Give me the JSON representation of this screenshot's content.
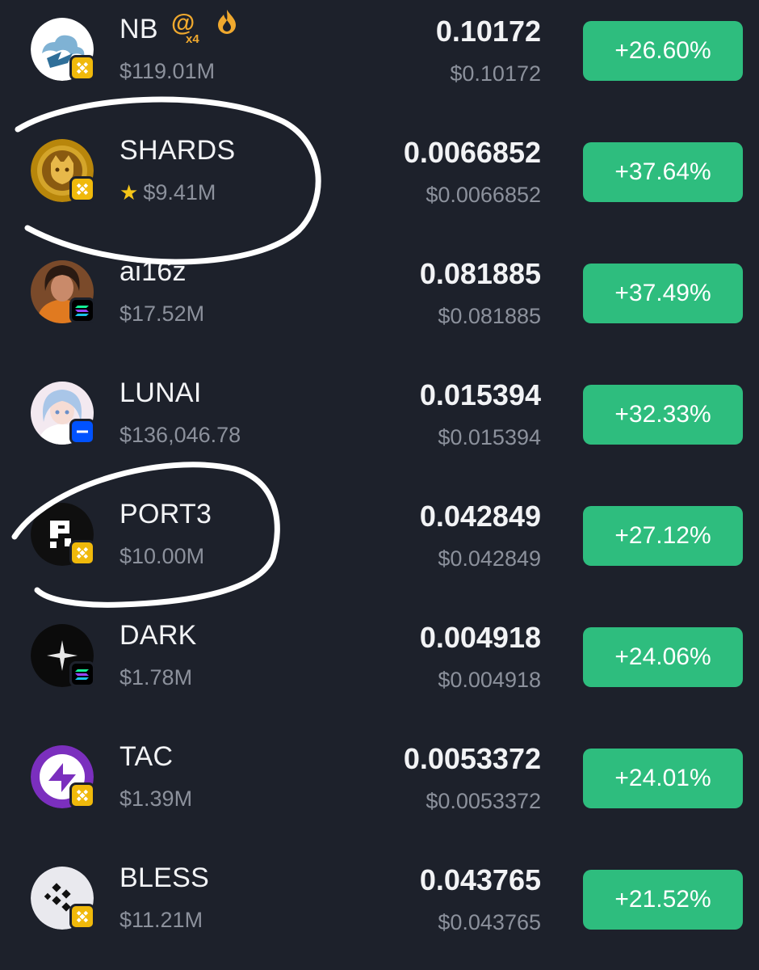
{
  "tokens": [
    {
      "name": "NB",
      "market_cap": "$119.01M",
      "price": "0.10172",
      "usd_price": "$0.10172",
      "change": "+26.60%",
      "chain": "bnb-chain-icon",
      "logo": "cloud-logo-icon",
      "badges": {
        "at_multiplier": "x4",
        "at_symbol": "@",
        "fire": "flame-icon"
      }
    },
    {
      "name": "SHARDS",
      "market_cap": "$9.41M",
      "price": "0.0066852",
      "usd_price": "$0.0066852",
      "change": "+37.64%",
      "chain": "bnb-chain-icon",
      "logo": "gold-coin-logo-icon",
      "starred": true
    },
    {
      "name": "ai16z",
      "market_cap": "$17.52M",
      "price": "0.081885",
      "usd_price": "$0.081885",
      "change": "+37.49%",
      "chain": "solana-chain-icon",
      "logo": "avatar-logo-icon"
    },
    {
      "name": "LUNAI",
      "market_cap": "$136,046.78",
      "price": "0.015394",
      "usd_price": "$0.015394",
      "change": "+32.33%",
      "chain": "base-chain-icon",
      "logo": "anime-avatar-logo-icon"
    },
    {
      "name": "PORT3",
      "market_cap": "$10.00M",
      "price": "0.042849",
      "usd_price": "$0.042849",
      "change": "+27.12%",
      "chain": "bnb-chain-icon",
      "logo": "port3-logo-icon"
    },
    {
      "name": "DARK",
      "market_cap": "$1.78M",
      "price": "0.004918",
      "usd_price": "$0.004918",
      "change": "+24.06%",
      "chain": "solana-chain-icon",
      "logo": "sparkle-logo-icon"
    },
    {
      "name": "TAC",
      "market_cap": "$1.39M",
      "price": "0.0053372",
      "usd_price": "$0.0053372",
      "change": "+24.01%",
      "chain": "bnb-chain-icon",
      "logo": "tac-logo-icon"
    },
    {
      "name": "BLESS",
      "market_cap": "$11.21M",
      "price": "0.043765",
      "usd_price": "$0.043765",
      "change": "+21.52%",
      "chain": "bnb-chain-icon",
      "logo": "bless-logo-icon"
    }
  ],
  "colors": {
    "background": "#1d212b",
    "positive": "#2ebd7e",
    "muted_text": "#8c919c",
    "bnb": "#f0b90b",
    "base": "#0052ff",
    "annotation": "#ffffff"
  },
  "annotations": [
    "circle-around-shards",
    "circle-around-port3"
  ]
}
